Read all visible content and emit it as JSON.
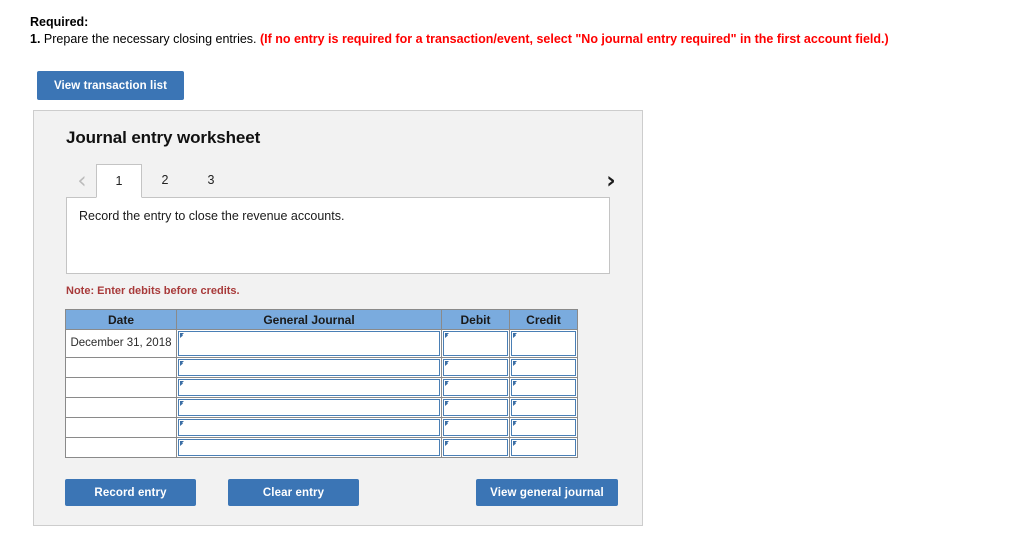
{
  "required": {
    "label": "Required:",
    "item_number": "1.",
    "item_text": " Prepare the necessary closing entries. ",
    "note": "(If no entry is required for a transaction/event, select \"No journal entry required\" in the first account field.)"
  },
  "toolbar": {
    "view_transaction_list_label": "View transaction list"
  },
  "worksheet": {
    "title": "Journal entry worksheet",
    "prev_icon": "chevron-left-icon",
    "next_icon": "chevron-right-icon",
    "prev_glyph": "‹",
    "next_glyph": "›",
    "tabs": [
      {
        "label": "1",
        "active": true
      },
      {
        "label": "2",
        "active": false
      },
      {
        "label": "3",
        "active": false
      }
    ],
    "instruction": "Record the entry to close the revenue accounts.",
    "note": "Note: Enter debits before credits.",
    "table": {
      "columns": [
        "Date",
        "General Journal",
        "Debit",
        "Credit"
      ],
      "rows": [
        {
          "date": "December 31, 2018",
          "general_journal": "",
          "debit": "",
          "credit": ""
        },
        {
          "date": "",
          "general_journal": "",
          "debit": "",
          "credit": ""
        },
        {
          "date": "",
          "general_journal": "",
          "debit": "",
          "credit": ""
        },
        {
          "date": "",
          "general_journal": "",
          "debit": "",
          "credit": ""
        },
        {
          "date": "",
          "general_journal": "",
          "debit": "",
          "credit": ""
        },
        {
          "date": "",
          "general_journal": "",
          "debit": "",
          "credit": ""
        }
      ]
    },
    "actions": {
      "record_entry_label": "Record entry",
      "clear_entry_label": "Clear entry",
      "view_general_journal_label": "View general journal"
    }
  },
  "colors": {
    "button_blue": "#3b75b5",
    "table_header_blue": "#7aabde",
    "alert_red": "#ff0000",
    "note_red": "#a83a3a",
    "panel_bg": "#f2f2f2",
    "input_border_blue": "#4a7fb5"
  }
}
